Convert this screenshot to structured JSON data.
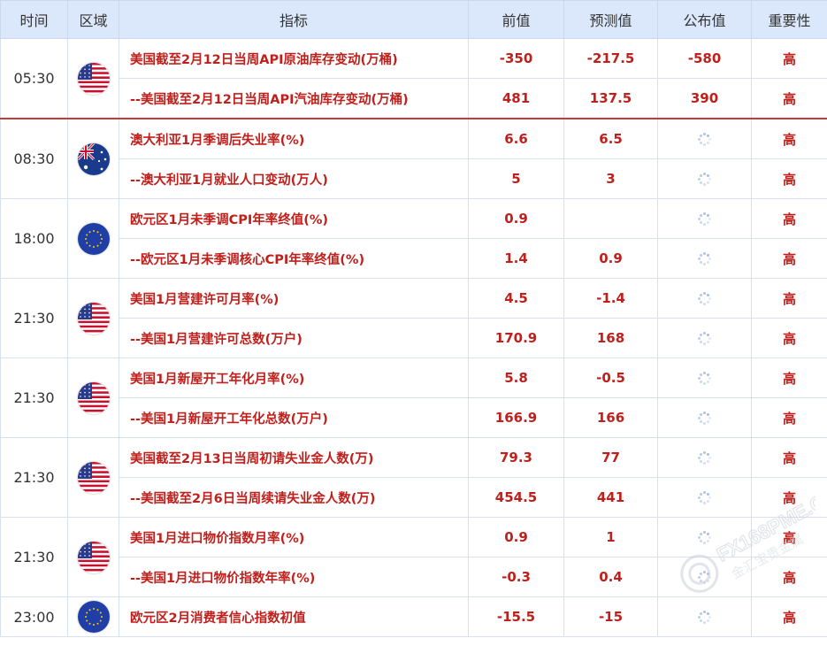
{
  "header": {
    "time": "时间",
    "region": "区域",
    "indicator": "指标",
    "previous": "前值",
    "forecast": "预测值",
    "actual": "公布值",
    "importance": "重要性"
  },
  "groups": [
    {
      "time": "05:30",
      "flag": "us-flag-icon",
      "rows": [
        {
          "indicator": "美国截至2月12日当周API原油库存变动(万桶)",
          "previous": "-350",
          "forecast": "-217.5",
          "actual": "-580",
          "importance": "高"
        },
        {
          "indicator": "--美国截至2月12日当周API汽油库存变动(万桶)",
          "previous": "481",
          "forecast": "137.5",
          "actual": "390",
          "importance": "高"
        }
      ]
    },
    {
      "time": "08:30",
      "flag": "australia-flag-icon",
      "rows": [
        {
          "indicator": "澳大利亚1月季调后失业率(%)",
          "previous": "6.6",
          "forecast": "6.5",
          "actual": "",
          "importance": "高"
        },
        {
          "indicator": "--澳大利亚1月就业人口变动(万人)",
          "previous": "5",
          "forecast": "3",
          "actual": "",
          "importance": "高"
        }
      ]
    },
    {
      "time": "18:00",
      "flag": "eu-flag-icon",
      "rows": [
        {
          "indicator": "欧元区1月未季调CPI年率终值(%)",
          "previous": "0.9",
          "forecast": "",
          "actual": "",
          "importance": "高"
        },
        {
          "indicator": "--欧元区1月未季调核心CPI年率终值(%)",
          "previous": "1.4",
          "forecast": "0.9",
          "actual": "",
          "importance": "高"
        }
      ]
    },
    {
      "time": "21:30",
      "flag": "us-flag-icon",
      "rows": [
        {
          "indicator": "美国1月营建许可月率(%)",
          "previous": "4.5",
          "forecast": "-1.4",
          "actual": "",
          "importance": "高"
        },
        {
          "indicator": "--美国1月营建许可总数(万户)",
          "previous": "170.9",
          "forecast": "168",
          "actual": "",
          "importance": "高"
        }
      ]
    },
    {
      "time": "21:30",
      "flag": "us-flag-icon",
      "rows": [
        {
          "indicator": "美国1月新屋开工年化月率(%)",
          "previous": "5.8",
          "forecast": "-0.5",
          "actual": "",
          "importance": "高"
        },
        {
          "indicator": "--美国1月新屋开工年化总数(万户)",
          "previous": "166.9",
          "forecast": "166",
          "actual": "",
          "importance": "高"
        }
      ]
    },
    {
      "time": "21:30",
      "flag": "us-flag-icon",
      "rows": [
        {
          "indicator": "美国截至2月13日当周初请失业金人数(万)",
          "previous": "79.3",
          "forecast": "77",
          "actual": "",
          "importance": "高"
        },
        {
          "indicator": "--美国截至2月6日当周续请失业金人数(万)",
          "previous": "454.5",
          "forecast": "441",
          "actual": "",
          "importance": "高"
        }
      ]
    },
    {
      "time": "21:30",
      "flag": "us-flag-icon",
      "rows": [
        {
          "indicator": "美国1月进口物价指数月率(%)",
          "previous": "0.9",
          "forecast": "1",
          "actual": "",
          "importance": "高"
        },
        {
          "indicator": "--美国1月进口物价指数年率(%)",
          "previous": "-0.3",
          "forecast": "0.4",
          "actual": "",
          "importance": "高"
        }
      ]
    },
    {
      "time": "23:00",
      "flag": "eu-flag-icon",
      "rows": [
        {
          "indicator": "欧元区2月消费者信心指数初值",
          "previous": "-15.5",
          "forecast": "-15",
          "actual": "",
          "importance": "高"
        }
      ]
    }
  ],
  "watermark": {
    "text": "FX168PME.COM",
    "subtext": "金汇宝贵金属",
    "icon": "watermark-logo-icon"
  },
  "colors": {
    "header_bg": "#dbe8fb",
    "value_red": "#c0201c",
    "separator_red": "#c83a3a",
    "border": "#d6e1f0"
  }
}
